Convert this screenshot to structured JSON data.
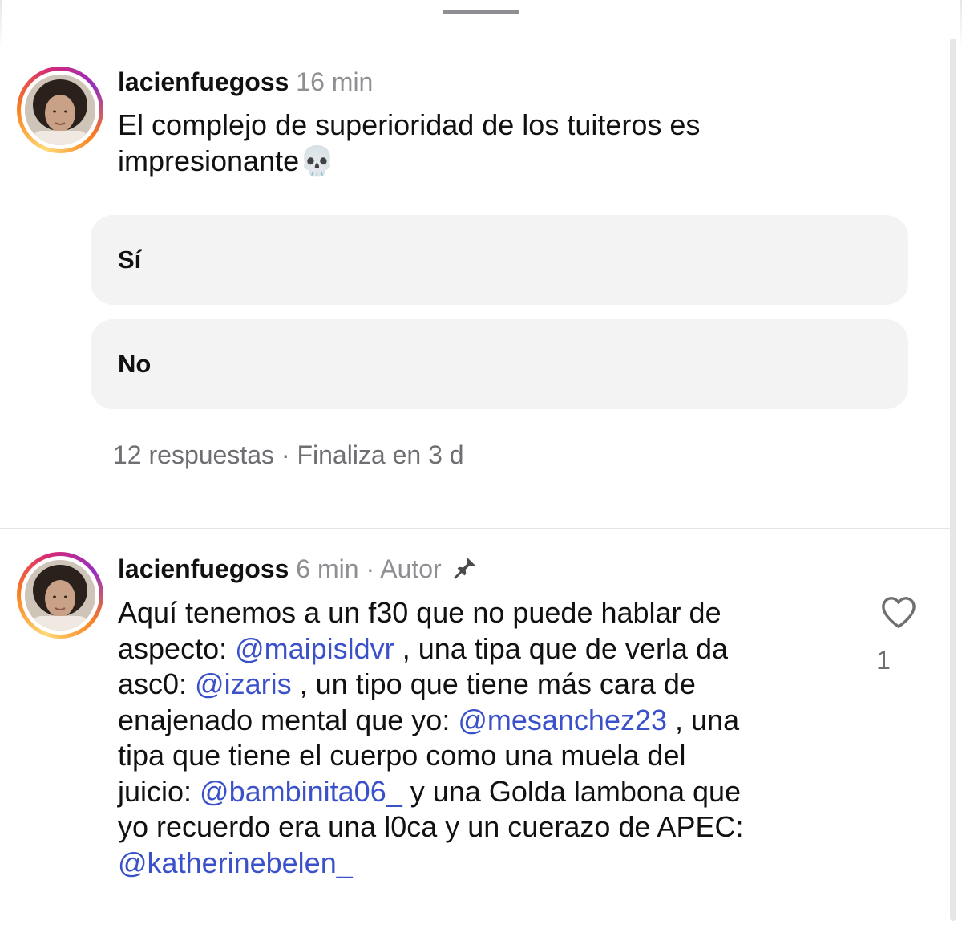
{
  "post": {
    "username": "lacienfuegoss",
    "time": "16 min",
    "text_line1": "El complejo de superioridad de los tuiteros es",
    "text_line2": "impresionante",
    "emoji": "💀",
    "poll": {
      "options": [
        "Sí",
        "No"
      ],
      "footer": "12 respuestas · Finaliza en 3 d"
    }
  },
  "reply": {
    "username": "lacienfuegoss",
    "time": "6 min",
    "separator": "·",
    "author_label": "Autor",
    "likes": "1",
    "lines": [
      {
        "pre": "Aquí tenemos a un f30 que no puede hablar de",
        "mention": "",
        "post": ""
      },
      {
        "pre": "aspecto: ",
        "mention": "@maipisldvr",
        "post": " , una tipa que de verla da"
      },
      {
        "pre": "asc0: ",
        "mention": "@izaris",
        "post": " , un tipo que tiene más cara de"
      },
      {
        "pre": "enajenado mental que yo: ",
        "mention": "@mesanchez23",
        "post": " , una"
      },
      {
        "pre": "tipa que tiene el cuerpo como una muela del",
        "mention": "",
        "post": ""
      },
      {
        "pre": "juicio: ",
        "mention": "@bambinita06_",
        "post": " y una Golda lambona que"
      },
      {
        "pre": "yo recuerdo era una l0ca y un cuerazo de APEC:",
        "mention": "",
        "post": ""
      },
      {
        "pre": "",
        "mention": "@katherinebelen_",
        "post": ""
      }
    ]
  },
  "icons": {
    "pin": "pin-icon",
    "like": "heart-icon",
    "skull": "skull-emoji"
  },
  "colors": {
    "mention": "#3b51c9",
    "meta": "#8e8e93",
    "poll_bg": "#f3f3f4"
  }
}
